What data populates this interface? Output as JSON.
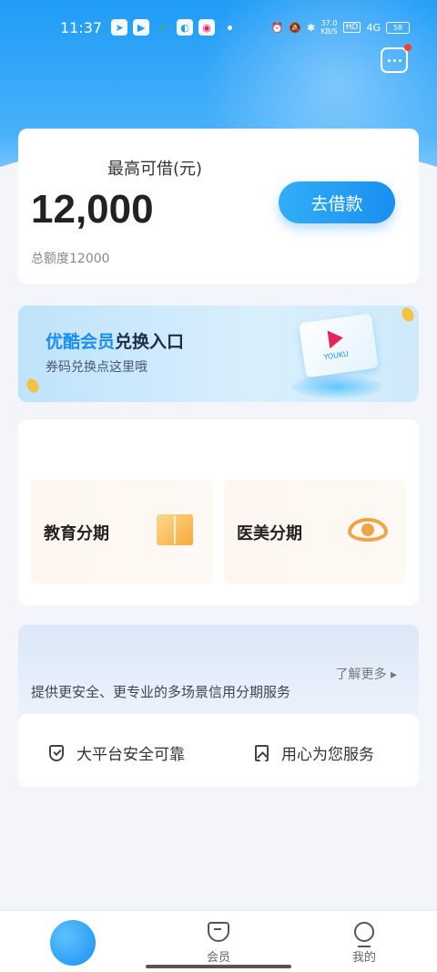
{
  "status_bar": {
    "time": "11:37",
    "net_speed_value": "37.0",
    "net_speed_unit": "KB/S",
    "hd": "HD",
    "signal": "4G",
    "battery": "58"
  },
  "loan": {
    "label": "最高可借(元)",
    "amount": "12,000",
    "total": "总额度12000",
    "button": "去借款"
  },
  "banner": {
    "brand": "优酷会员",
    "title_rest": "兑换入口",
    "subtitle": "券码兑换点这里哦",
    "ticket_text": "YOUKU"
  },
  "installments": [
    {
      "label": "教育分期",
      "icon": "book-icon"
    },
    {
      "label": "医美分期",
      "icon": "eye-icon"
    }
  ],
  "service": {
    "learn_more": "了解更多 ▸",
    "description": "提供更安全、更专业的多场景信用分期服务",
    "features": [
      {
        "label": "大平台安全可靠",
        "icon": "shield-icon"
      },
      {
        "label": "用心为您服务",
        "icon": "bookmark-icon"
      }
    ]
  },
  "tabs": [
    {
      "label": "",
      "icon": "home-icon"
    },
    {
      "label": "会员",
      "icon": "member-icon"
    },
    {
      "label": "我的",
      "icon": "person-icon"
    }
  ],
  "colors": {
    "accent": "#1a8ff1",
    "background": "#f3f5fa",
    "notification_dot": "#f5412e"
  }
}
